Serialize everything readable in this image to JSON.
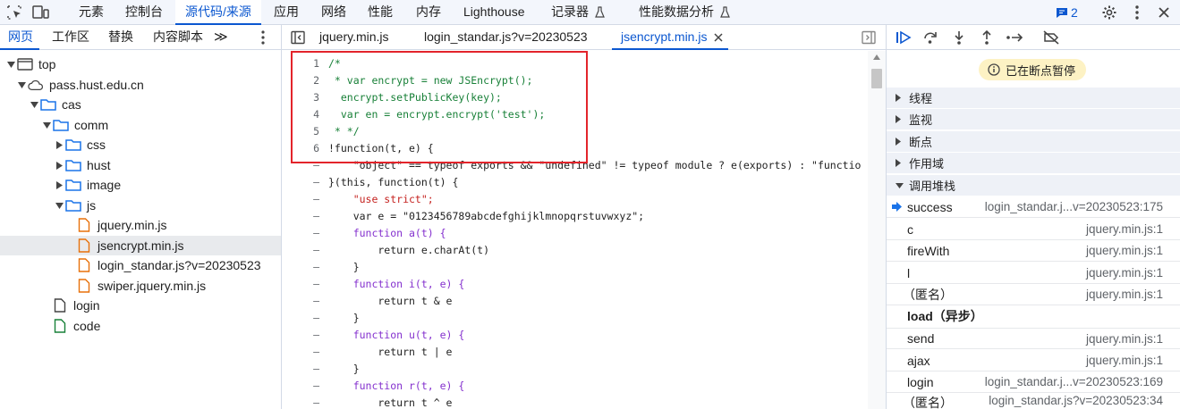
{
  "toolbar": {
    "tabs": [
      "元素",
      "控制台",
      "源代码/来源",
      "应用",
      "网络",
      "性能",
      "内存",
      "Lighthouse",
      "记录器",
      "性能数据分析"
    ],
    "issues_count": "2"
  },
  "left_panel": {
    "tabs": [
      "网页",
      "工作区",
      "替换",
      "内容脚本"
    ],
    "more": "≫",
    "tree": [
      "top",
      "pass.hust.edu.cn",
      "cas",
      "comm",
      "css",
      "hust",
      "image",
      "js",
      "jquery.min.js",
      "jsencrypt.min.js",
      "login_standar.js?v=20230523",
      "swiper.jquery.min.js",
      "login",
      "code"
    ]
  },
  "editor": {
    "tabs": [
      "jquery.min.js",
      "login_standar.js?v=20230523",
      "jsencrypt.min.js"
    ],
    "line_numbers": [
      "1",
      "2",
      "3",
      "4",
      "5",
      "6",
      "–",
      "–",
      "–",
      "–",
      "–",
      "–",
      "–",
      "–",
      "–",
      "–",
      "–",
      "–",
      "–",
      "–",
      "–"
    ],
    "lines": [
      "/*",
      " * var encrypt = new JSEncrypt();",
      "  encrypt.setPublicKey(key);",
      "  var en = encrypt.encrypt('test');",
      " * */",
      "!function(t, e) {",
      "    \"object\" == typeof exports && \"undefined\" != typeof module ? e(exports) : \"functio",
      "}(this, function(t) {",
      "    \"use strict\";",
      "    var e = \"0123456789abcdefghijklmnopqrstuvwxyz\";",
      "    function a(t) {",
      "        return e.charAt(t)",
      "    }",
      "    function i(t, e) {",
      "        return t & e",
      "    }",
      "    function u(t, e) {",
      "        return t | e",
      "    }",
      "    function r(t, e) {",
      "        return t ^ e"
    ]
  },
  "debugger": {
    "paused_text": "已在断点暂停",
    "sections": [
      "线程",
      "监视",
      "断点",
      "作用域",
      "调用堆栈"
    ],
    "call_stack": [
      {
        "fn": "success",
        "loc": "login_standar.j...v=20230523:175"
      },
      {
        "fn": "c",
        "loc": "jquery.min.js:1"
      },
      {
        "fn": "fireWith",
        "loc": "jquery.min.js:1"
      },
      {
        "fn": "l",
        "loc": "jquery.min.js:1"
      },
      {
        "fn": "（匿名）",
        "loc": "jquery.min.js:1"
      },
      {
        "fn": "load（异步）",
        "loc": ""
      },
      {
        "fn": "send",
        "loc": "jquery.min.js:1"
      },
      {
        "fn": "ajax",
        "loc": "jquery.min.js:1"
      },
      {
        "fn": "login",
        "loc": "login_standar.j...v=20230523:169"
      },
      {
        "fn": "（匿名）",
        "loc": "login_standar.js?v=20230523:34"
      }
    ]
  },
  "colors": {
    "accent": "#0b57d0",
    "highlight_box": "#e3242b",
    "folder": "#1a73e8",
    "js_file": "#e8710a",
    "doc_file_green": "#188038"
  }
}
